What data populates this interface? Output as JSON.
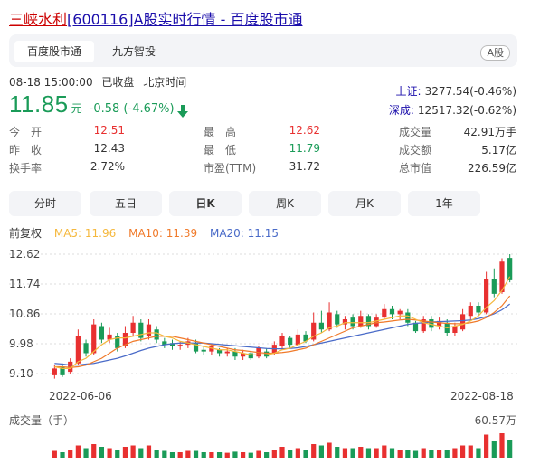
{
  "header": {
    "stock_name": "三峡水利",
    "title_rest": "[600116]A股实时行情 - 百度股市通"
  },
  "tabs": [
    {
      "label": "百度股市通",
      "active": true
    },
    {
      "label": "九方智投",
      "active": false
    }
  ],
  "badge": "A股",
  "status": {
    "time": "08-18 15:00:00",
    "state": "已收盘",
    "tz": "北京时间"
  },
  "quote": {
    "price": "11.85",
    "unit": "元",
    "change": "-0.58 (-4.67%)",
    "direction": "down",
    "color": "#1a9b58"
  },
  "indices": [
    {
      "name": "上证:",
      "value": "3277.54(-0.46%)"
    },
    {
      "name": "深成:",
      "value": "12517.32(-0.62%)"
    }
  ],
  "stats": [
    [
      {
        "label": "今　开",
        "value": "12.51",
        "color": "red"
      },
      {
        "label": "昨　收",
        "value": "12.43",
        "color": ""
      },
      {
        "label": "换手率",
        "value": "2.72%",
        "color": ""
      }
    ],
    [
      {
        "label": "最　高",
        "value": "12.62",
        "color": "red"
      },
      {
        "label": "最　低",
        "value": "11.79",
        "color": "grn"
      },
      {
        "label": "市盈(TTM)",
        "value": "31.72",
        "color": ""
      }
    ],
    [
      {
        "label": "成交量",
        "value": "42.91万手",
        "color": ""
      },
      {
        "label": "成交额",
        "value": "5.17亿",
        "color": ""
      },
      {
        "label": "总市值",
        "value": "226.59亿",
        "color": ""
      }
    ]
  ],
  "periods": [
    {
      "label": "分时",
      "active": false
    },
    {
      "label": "五日",
      "active": false
    },
    {
      "label": "日K",
      "active": true
    },
    {
      "label": "周K",
      "active": false
    },
    {
      "label": "月K",
      "active": false
    },
    {
      "label": "1年",
      "active": false
    }
  ],
  "legend": {
    "adjust": "前复权",
    "ma5": "MA5: 11.96",
    "ma10": "MA10: 11.39",
    "ma20": "MA20: 11.15"
  },
  "colors": {
    "up": "#e83030",
    "down": "#1a9b58",
    "ma5": "#f5b83d",
    "ma10": "#f07a2a",
    "ma20": "#4a6bc8"
  },
  "volume": {
    "label": "成交量（手）",
    "max_label": "60.57万"
  },
  "chart_data": {
    "type": "candlestick",
    "y_ticks": [
      "12.62",
      "11.74",
      "10.86",
      "9.98",
      "9.10"
    ],
    "ylim": [
      9.1,
      12.62
    ],
    "x_start_label": "2022-06-06",
    "x_end_label": "2022-08-18",
    "candles": [
      {
        "o": 9.05,
        "c": 9.25,
        "h": 9.35,
        "l": 8.95
      },
      {
        "o": 9.3,
        "c": 9.05,
        "h": 9.4,
        "l": 9.0
      },
      {
        "o": 9.15,
        "c": 9.45,
        "h": 9.55,
        "l": 9.1
      },
      {
        "o": 9.4,
        "c": 10.2,
        "h": 10.4,
        "l": 9.35
      },
      {
        "o": 10.0,
        "c": 9.7,
        "h": 10.1,
        "l": 9.6
      },
      {
        "o": 9.7,
        "c": 10.55,
        "h": 10.7,
        "l": 9.65
      },
      {
        "o": 10.5,
        "c": 10.1,
        "h": 10.6,
        "l": 10.0
      },
      {
        "o": 10.1,
        "c": 10.25,
        "h": 10.45,
        "l": 10.0
      },
      {
        "o": 10.2,
        "c": 9.85,
        "h": 10.3,
        "l": 9.75
      },
      {
        "o": 9.9,
        "c": 10.3,
        "h": 10.5,
        "l": 9.85
      },
      {
        "o": 10.3,
        "c": 10.6,
        "h": 10.8,
        "l": 10.2
      },
      {
        "o": 10.6,
        "c": 10.15,
        "h": 10.7,
        "l": 10.05
      },
      {
        "o": 10.2,
        "c": 10.55,
        "h": 10.7,
        "l": 10.1
      },
      {
        "o": 10.4,
        "c": 10.1,
        "h": 10.5,
        "l": 10.0
      },
      {
        "o": 10.05,
        "c": 9.95,
        "h": 10.15,
        "l": 9.85
      },
      {
        "o": 10.0,
        "c": 9.9,
        "h": 10.1,
        "l": 9.8
      },
      {
        "o": 9.9,
        "c": 9.95,
        "h": 10.05,
        "l": 9.8
      },
      {
        "o": 9.95,
        "c": 10.05,
        "h": 10.15,
        "l": 9.85
      },
      {
        "o": 10.0,
        "c": 9.75,
        "h": 10.1,
        "l": 9.7
      },
      {
        "o": 9.8,
        "c": 9.75,
        "h": 9.9,
        "l": 9.65
      },
      {
        "o": 9.75,
        "c": 9.9,
        "h": 9.95,
        "l": 9.65
      },
      {
        "o": 9.8,
        "c": 9.7,
        "h": 9.85,
        "l": 9.6
      },
      {
        "o": 9.7,
        "c": 9.75,
        "h": 9.85,
        "l": 9.6
      },
      {
        "o": 9.75,
        "c": 9.6,
        "h": 9.85,
        "l": 9.5
      },
      {
        "o": 9.6,
        "c": 9.7,
        "h": 9.8,
        "l": 9.5
      },
      {
        "o": 9.7,
        "c": 9.55,
        "h": 9.75,
        "l": 9.5
      },
      {
        "o": 9.6,
        "c": 9.85,
        "h": 9.9,
        "l": 9.55
      },
      {
        "o": 9.75,
        "c": 9.6,
        "h": 9.85,
        "l": 9.55
      },
      {
        "o": 9.7,
        "c": 9.95,
        "h": 10.05,
        "l": 9.65
      },
      {
        "o": 9.9,
        "c": 10.2,
        "h": 10.3,
        "l": 9.8
      },
      {
        "o": 10.15,
        "c": 9.95,
        "h": 10.2,
        "l": 9.85
      },
      {
        "o": 9.95,
        "c": 10.25,
        "h": 10.4,
        "l": 9.9
      },
      {
        "o": 10.25,
        "c": 10.05,
        "h": 10.35,
        "l": 10.0
      },
      {
        "o": 10.1,
        "c": 10.6,
        "h": 10.9,
        "l": 10.05
      },
      {
        "o": 10.6,
        "c": 10.4,
        "h": 10.95,
        "l": 10.3
      },
      {
        "o": 10.4,
        "c": 10.9,
        "h": 11.2,
        "l": 10.35
      },
      {
        "o": 10.85,
        "c": 10.55,
        "h": 10.95,
        "l": 10.45
      },
      {
        "o": 10.55,
        "c": 10.7,
        "h": 10.8,
        "l": 10.4
      },
      {
        "o": 10.75,
        "c": 10.5,
        "h": 10.85,
        "l": 10.4
      },
      {
        "o": 10.5,
        "c": 10.8,
        "h": 10.95,
        "l": 10.45
      },
      {
        "o": 10.8,
        "c": 10.5,
        "h": 10.85,
        "l": 10.4
      },
      {
        "o": 10.5,
        "c": 10.75,
        "h": 10.85,
        "l": 10.45
      },
      {
        "o": 10.75,
        "c": 11.0,
        "h": 11.15,
        "l": 10.7
      },
      {
        "o": 11.0,
        "c": 10.85,
        "h": 11.1,
        "l": 10.7
      },
      {
        "o": 10.85,
        "c": 10.95,
        "h": 11.0,
        "l": 10.7
      },
      {
        "o": 10.9,
        "c": 10.6,
        "h": 11.0,
        "l": 10.5
      },
      {
        "o": 10.6,
        "c": 10.35,
        "h": 10.65,
        "l": 10.3
      },
      {
        "o": 10.35,
        "c": 10.7,
        "h": 10.8,
        "l": 10.3
      },
      {
        "o": 10.7,
        "c": 10.45,
        "h": 10.8,
        "l": 10.35
      },
      {
        "o": 10.5,
        "c": 10.65,
        "h": 10.75,
        "l": 10.4
      },
      {
        "o": 10.6,
        "c": 10.3,
        "h": 10.7,
        "l": 10.2
      },
      {
        "o": 10.3,
        "c": 10.5,
        "h": 10.6,
        "l": 10.2
      },
      {
        "o": 10.4,
        "c": 10.85,
        "h": 11.0,
        "l": 10.35
      },
      {
        "o": 10.8,
        "c": 11.1,
        "h": 11.2,
        "l": 10.7
      },
      {
        "o": 11.1,
        "c": 10.9,
        "h": 11.2,
        "l": 10.8
      },
      {
        "o": 10.9,
        "c": 11.9,
        "h": 12.1,
        "l": 10.85
      },
      {
        "o": 11.9,
        "c": 11.45,
        "h": 12.2,
        "l": 11.35
      },
      {
        "o": 11.5,
        "c": 12.4,
        "h": 12.5,
        "l": 11.45
      },
      {
        "o": 12.51,
        "c": 11.85,
        "h": 12.62,
        "l": 11.79
      }
    ],
    "ma5": [
      9.3,
      9.25,
      9.25,
      9.45,
      9.55,
      9.75,
      9.95,
      10.1,
      10.15,
      10.15,
      10.2,
      10.25,
      10.3,
      10.3,
      10.2,
      10.15,
      10.05,
      10.0,
      9.95,
      9.9,
      9.85,
      9.8,
      9.8,
      9.75,
      9.7,
      9.65,
      9.65,
      9.65,
      9.7,
      9.8,
      9.85,
      9.95,
      10.05,
      10.2,
      10.3,
      10.45,
      10.5,
      10.6,
      10.6,
      10.6,
      10.6,
      10.65,
      10.7,
      10.75,
      10.8,
      10.8,
      10.7,
      10.6,
      10.55,
      10.5,
      10.45,
      10.5,
      10.55,
      10.65,
      10.8,
      11.05,
      11.25,
      11.55,
      11.96
    ],
    "ma10": [
      9.3,
      9.3,
      9.28,
      9.3,
      9.35,
      9.45,
      9.55,
      9.7,
      9.85,
      9.95,
      10.05,
      10.1,
      10.15,
      10.2,
      10.2,
      10.2,
      10.15,
      10.1,
      10.05,
      10.0,
      9.95,
      9.9,
      9.85,
      9.8,
      9.78,
      9.75,
      9.72,
      9.7,
      9.7,
      9.72,
      9.75,
      9.8,
      9.85,
      9.95,
      10.05,
      10.15,
      10.25,
      10.35,
      10.45,
      10.5,
      10.55,
      10.6,
      10.62,
      10.65,
      10.68,
      10.7,
      10.68,
      10.65,
      10.62,
      10.6,
      10.58,
      10.57,
      10.57,
      10.6,
      10.65,
      10.75,
      10.9,
      11.1,
      11.39
    ],
    "ma20": [
      9.4,
      9.38,
      9.35,
      9.35,
      9.38,
      9.4,
      9.45,
      9.5,
      9.55,
      9.62,
      9.7,
      9.78,
      9.85,
      9.9,
      9.95,
      9.98,
      10.0,
      10.0,
      10.0,
      10.0,
      9.98,
      9.96,
      9.94,
      9.92,
      9.9,
      9.88,
      9.86,
      9.84,
      9.83,
      9.83,
      9.84,
      9.86,
      9.9,
      9.95,
      10.0,
      10.05,
      10.1,
      10.15,
      10.2,
      10.25,
      10.3,
      10.35,
      10.4,
      10.45,
      10.5,
      10.55,
      10.58,
      10.6,
      10.62,
      10.63,
      10.64,
      10.65,
      10.66,
      10.68,
      10.72,
      10.78,
      10.86,
      10.98,
      11.15
    ],
    "volumes": [
      0.25,
      0.2,
      0.3,
      0.45,
      0.35,
      0.5,
      0.4,
      0.35,
      0.3,
      0.4,
      0.45,
      0.35,
      0.45,
      0.3,
      0.25,
      0.2,
      0.2,
      0.25,
      0.25,
      0.2,
      0.2,
      0.2,
      0.18,
      0.22,
      0.2,
      0.18,
      0.25,
      0.2,
      0.3,
      0.4,
      0.3,
      0.35,
      0.3,
      0.5,
      0.45,
      0.55,
      0.4,
      0.35,
      0.35,
      0.4,
      0.35,
      0.35,
      0.45,
      0.35,
      0.3,
      0.3,
      0.25,
      0.35,
      0.3,
      0.3,
      0.3,
      0.35,
      0.45,
      0.45,
      0.35,
      0.85,
      0.6,
      0.9,
      0.65
    ]
  }
}
